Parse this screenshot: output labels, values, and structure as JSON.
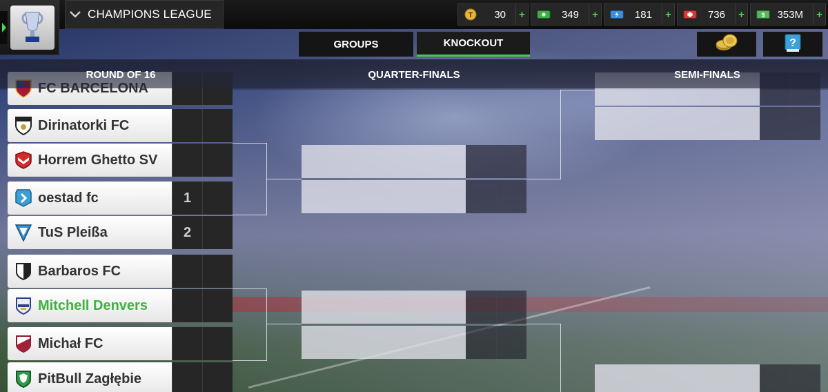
{
  "competition": {
    "title": "CHAMPIONS LEAGUE"
  },
  "currencies": [
    {
      "icon": "token-coin-icon",
      "value": "30",
      "color": "#e8b53a"
    },
    {
      "icon": "cash-icon",
      "value": "349",
      "color": "#3fae4a"
    },
    {
      "icon": "energy-icon",
      "value": "181",
      "color": "#3e8fe0"
    },
    {
      "icon": "health-icon",
      "value": "736",
      "color": "#d83a3a"
    },
    {
      "icon": "money-icon",
      "value": "353M",
      "color": "#3fae4a"
    }
  ],
  "tabs": {
    "groups": "GROUPS",
    "knockout": "KNOCKOUT",
    "active": "knockout"
  },
  "rounds": {
    "r16": "ROUND OF 16",
    "qf": "QUARTER-FINALS",
    "sf": "SEMI-FINALS"
  },
  "teams": [
    {
      "name": "FC BARCELONA",
      "score": "",
      "highlight": false
    },
    {
      "name": "Dirinatorki FC",
      "score": "",
      "highlight": false
    },
    {
      "name": "Horrem Ghetto SV",
      "score": "",
      "highlight": false
    },
    {
      "name": "oestad fc",
      "score": "1",
      "highlight": false
    },
    {
      "name": "TuS Pleißa",
      "score": "2",
      "highlight": false
    },
    {
      "name": "Barbaros FC",
      "score": "",
      "highlight": false
    },
    {
      "name": "Mitchell Denvers",
      "score": "",
      "highlight": true
    },
    {
      "name": "Michał FC",
      "score": "",
      "highlight": false
    },
    {
      "name": "PitBull Zagłębie",
      "score": "",
      "highlight": false
    }
  ],
  "colors": {
    "accent": "#44cc44",
    "highlight_team": "#3fb23f"
  }
}
